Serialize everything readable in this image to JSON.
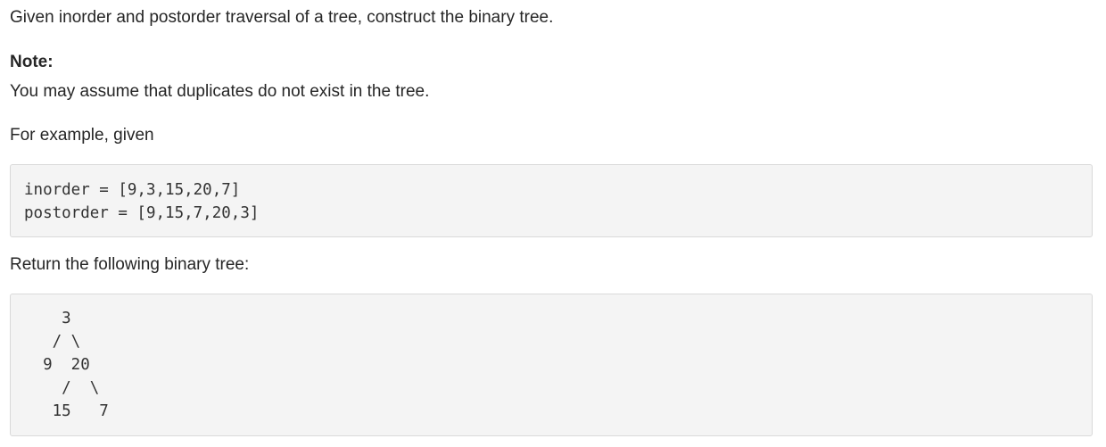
{
  "problem": {
    "intro": "Given inorder and postorder traversal of a tree, construct the binary tree.",
    "note_heading": "Note:",
    "note_text": "You may assume that duplicates do not exist in the tree.",
    "example_intro": "For example, given",
    "input_code": "inorder = [9,3,15,20,7]\npostorder = [9,15,7,20,3]",
    "return_text": "Return the following binary tree:",
    "tree_code": "    3\n   / \\\n  9  20\n    /  \\\n   15   7"
  }
}
